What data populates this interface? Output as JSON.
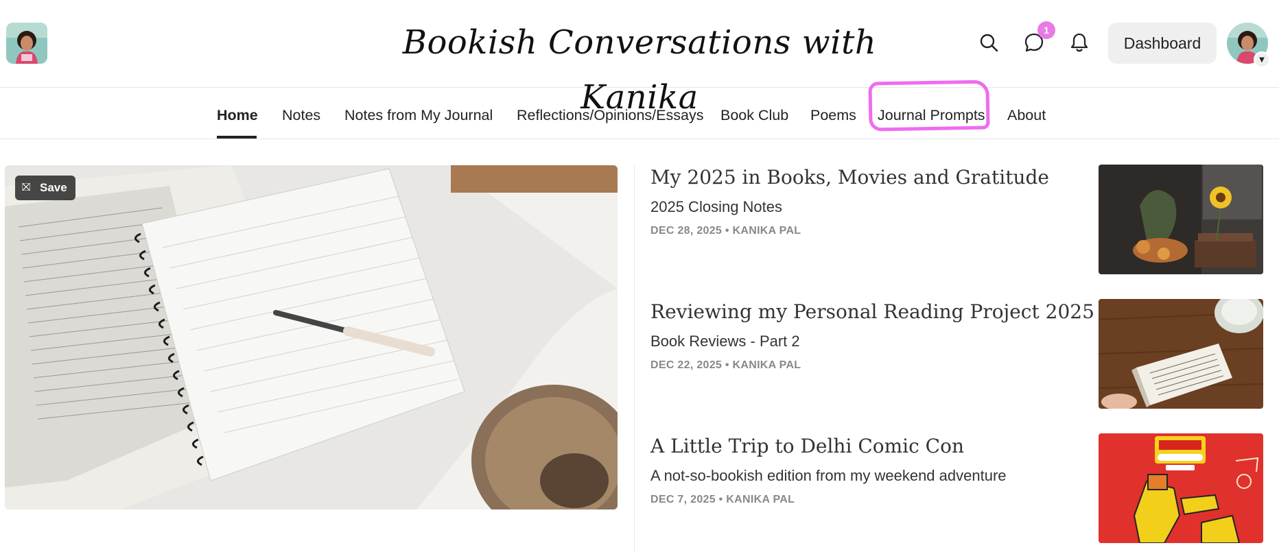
{
  "header": {
    "site_title": "Bookish Conversations with Kanika",
    "notification_count": "1",
    "dashboard_label": "Dashboard"
  },
  "icons": {
    "search": "search-icon",
    "chat": "chat-bubble-icon",
    "bell": "bell-icon",
    "caret": "chevron-down-icon",
    "save": "bookmark-icon"
  },
  "nav": {
    "items": [
      {
        "label": "Home"
      },
      {
        "label": "Notes"
      },
      {
        "label": "Notes from My Journal"
      },
      {
        "label": "Reflections/Opinions/Essays"
      },
      {
        "label": "Book Club"
      },
      {
        "label": "Poems"
      },
      {
        "label": "Journal Prompts"
      },
      {
        "label": "About"
      }
    ]
  },
  "featured": {
    "save_label": "Save"
  },
  "posts": [
    {
      "title": "My 2025 in Books, Movies and Gratitude",
      "subtitle": "2025 Closing Notes",
      "meta": "DEC 28, 2025 • KANIKA PAL"
    },
    {
      "title": "Reviewing my Personal Reading Project 2025",
      "subtitle": "Book Reviews - Part 2",
      "meta": "DEC 22, 2025 • KANIKA PAL"
    },
    {
      "title": "A Little Trip to Delhi Comic Con",
      "subtitle": "A not-so-bookish edition from my weekend adventure",
      "meta": "DEC 7, 2025 • KANIKA PAL"
    }
  ],
  "colors": {
    "highlight": "#ee6cf0",
    "badge": "#e87ae6",
    "accent": "#222222"
  }
}
